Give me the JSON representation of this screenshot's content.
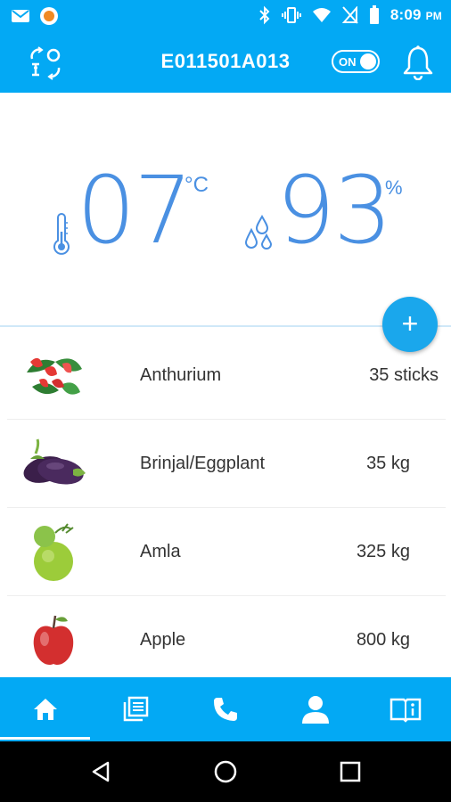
{
  "status_bar": {
    "time": "8:09",
    "ampm": "PM"
  },
  "app_bar": {
    "title": "E011501A013",
    "toggle_label": "ON"
  },
  "readings": {
    "temperature": "07",
    "temperature_unit": "°C",
    "humidity": "93",
    "humidity_unit": "%"
  },
  "fab": {
    "label": "+"
  },
  "items": [
    {
      "name": "Anthurium",
      "quantity": "35 sticks",
      "icon": "anthurium-image"
    },
    {
      "name": "Brinjal/Eggplant",
      "quantity": "35 kg",
      "icon": "eggplant-image"
    },
    {
      "name": "Amla",
      "quantity": "325 kg",
      "icon": "amla-image"
    },
    {
      "name": "Apple",
      "quantity": "800 kg",
      "icon": "apple-image"
    }
  ],
  "bottom_nav": [
    {
      "icon": "home-icon",
      "active": true
    },
    {
      "icon": "list-icon",
      "active": false
    },
    {
      "icon": "phone-icon",
      "active": false
    },
    {
      "icon": "person-icon",
      "active": false
    },
    {
      "icon": "book-info-icon",
      "active": false
    }
  ],
  "colors": {
    "primary": "#03a9f4",
    "reading": "#4a90e2",
    "fab": "#1aa7ec"
  }
}
